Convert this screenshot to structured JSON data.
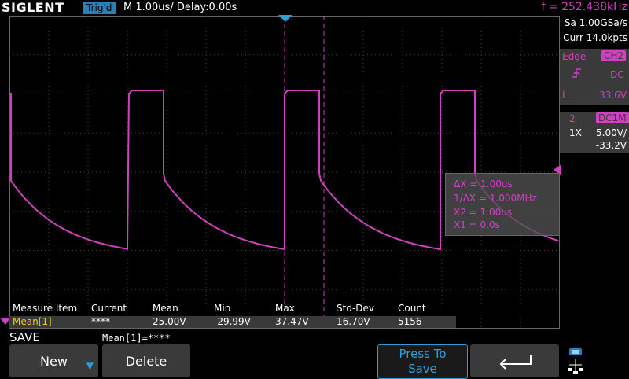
{
  "header": {
    "brand": "SIGLENT",
    "trigger_status": "Trig'd",
    "timebase": "M 1.00us/",
    "delay": "Delay:0.00s",
    "frequency": "f = 252.438kHz"
  },
  "acquisition": {
    "sample_rate": "Sa 1.00GSa/s",
    "memory": "Curr 14.0kpts"
  },
  "trigger_panel": {
    "type": "Edge",
    "source": "CH2",
    "coupling": "DC",
    "level_label": "L",
    "level": "33.6V"
  },
  "channel_panel": {
    "number": "2",
    "coupling": "DC1M",
    "probe": "1X",
    "scale": "5.00V/",
    "offset": "-33.2V"
  },
  "cursors": {
    "delta_x": "ΔX = 1.00us",
    "inv_delta_x": "1/ΔX = 1.000MHz",
    "x2": "X2 = 1.00us",
    "x1": "X1 = 0.0s"
  },
  "measure": {
    "headers": [
      "Measure Item",
      "Current",
      "Mean",
      "Min",
      "Max",
      "Std-Dev",
      "Count"
    ],
    "row": [
      "Mean[1]",
      "****",
      "25.00V",
      "-29.99V",
      "37.47V",
      "16.70V",
      "5156"
    ]
  },
  "menu": {
    "title": "SAVE",
    "status": "Mean[1]=****",
    "new_label": "New",
    "delete_label": "Delete",
    "press_to_save": "Press To Save",
    "press_line1": "Press To",
    "press_line2": "Save"
  },
  "colors": {
    "channel2": "#d040c0",
    "trigger_badge": "#2a7fb8",
    "panel": "#3a3a3a",
    "grid": "#555555"
  },
  "icons": {
    "back": "back-arrow-icon",
    "network": "network-icon"
  }
}
